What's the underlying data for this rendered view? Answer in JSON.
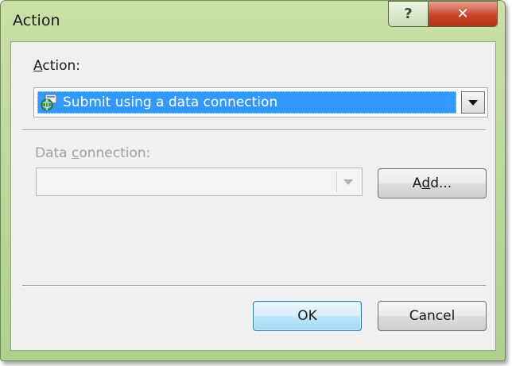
{
  "window": {
    "title": "Action",
    "help_glyph": "?",
    "close_glyph": "✕"
  },
  "action": {
    "label_accel": "A",
    "label_rest": "ction:",
    "selected_value": "Submit using a data connection",
    "icon": "data-connection-globe-icon"
  },
  "data_connection": {
    "label_pre": "Data ",
    "label_accel": "c",
    "label_rest": "onnection:",
    "value": "",
    "disabled": true
  },
  "buttons": {
    "add_pre": "A",
    "add_accel": "d",
    "add_rest": "d...",
    "ok": "OK",
    "cancel": "Cancel"
  },
  "colors": {
    "frame": "#b6d696",
    "selection": "#3399ff",
    "close_button": "#c9452b",
    "client_bg": "#f0f0f0"
  }
}
